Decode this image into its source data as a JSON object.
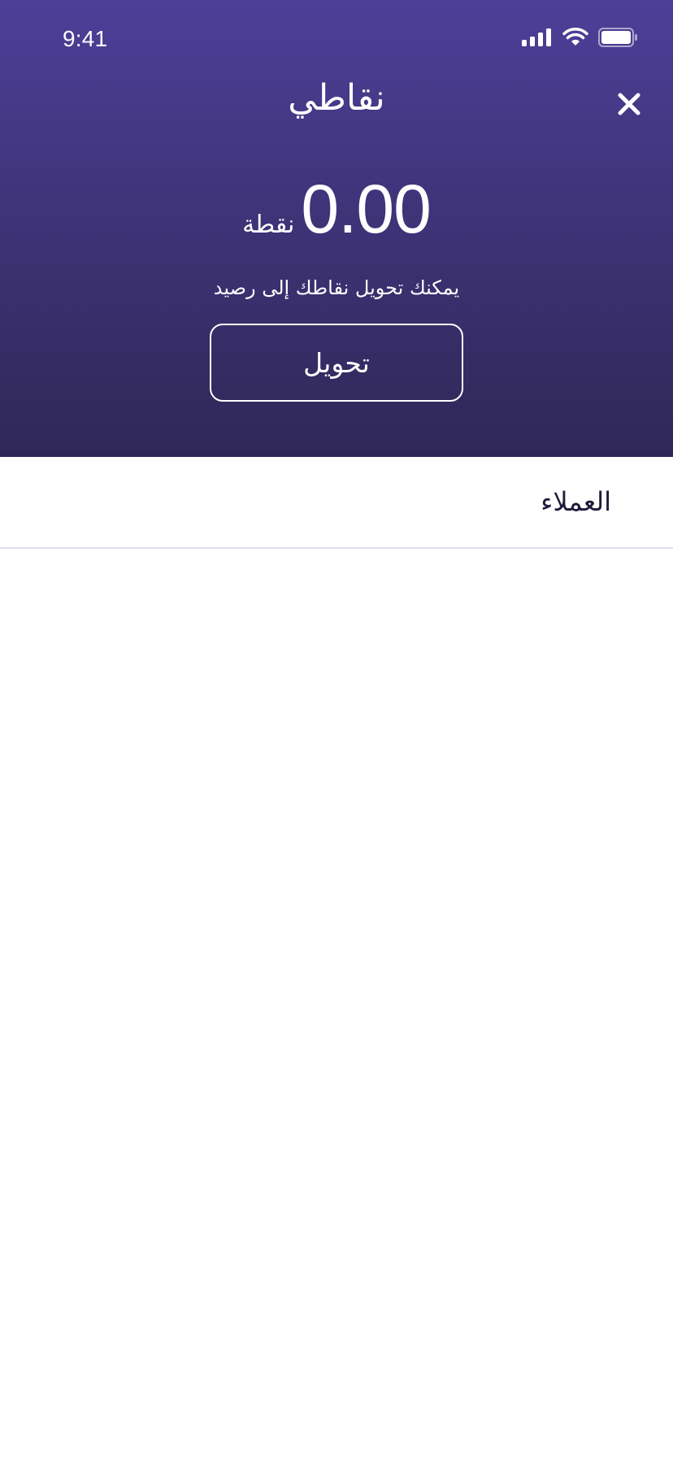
{
  "status_bar": {
    "time": "9:41"
  },
  "header": {
    "title": "نقاطي",
    "close_icon": "close-icon",
    "points_value": "0.00",
    "points_unit": "نقطة",
    "hint": "يمكنك تحويل نقاطك إلى رصيد",
    "convert_label": "تحويل"
  },
  "section": {
    "title": "العملاء"
  },
  "colors": {
    "header_top": "#4d3f98",
    "header_bottom": "#2f2757",
    "section_text": "#1f1a3a",
    "divider": "#e1e1ec"
  }
}
